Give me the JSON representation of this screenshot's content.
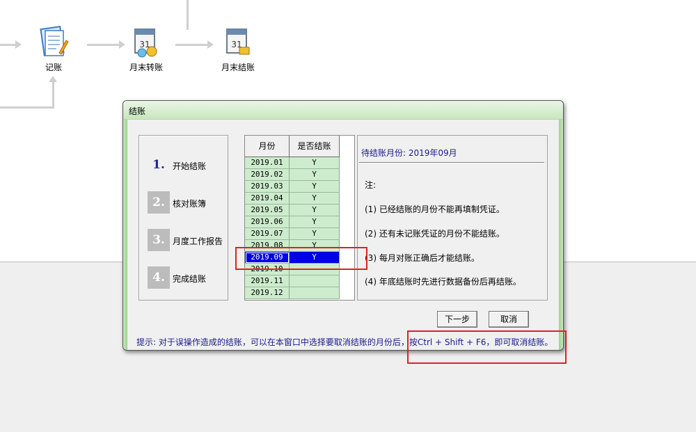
{
  "flow": {
    "nodes": [
      {
        "label": "记账",
        "icon": "ledger-icon"
      },
      {
        "label": "月末转账",
        "icon": "calendar-transfer-icon"
      },
      {
        "label": "月末结账",
        "icon": "calendar-close-icon"
      }
    ]
  },
  "dialog": {
    "title": "结账",
    "steps": [
      {
        "num": "1.",
        "label": "开始结账",
        "active": true
      },
      {
        "num": "2.",
        "label": "核对账簿",
        "active": false
      },
      {
        "num": "3.",
        "label": "月度工作报告",
        "active": false
      },
      {
        "num": "4.",
        "label": "完成结账",
        "active": false
      }
    ],
    "table": {
      "headers": [
        "月份",
        "是否结账"
      ],
      "rows": [
        {
          "month": "2019.01",
          "closed": "Y"
        },
        {
          "month": "2019.02",
          "closed": "Y"
        },
        {
          "month": "2019.03",
          "closed": "Y"
        },
        {
          "month": "2019.04",
          "closed": "Y"
        },
        {
          "month": "2019.05",
          "closed": "Y"
        },
        {
          "month": "2019.06",
          "closed": "Y"
        },
        {
          "month": "2019.07",
          "closed": "Y"
        },
        {
          "month": "2019.08",
          "closed": "Y"
        },
        {
          "month": "2019.09",
          "closed": "Y"
        },
        {
          "month": "2019.10",
          "closed": ""
        },
        {
          "month": "2019.11",
          "closed": ""
        },
        {
          "month": "2019.12",
          "closed": ""
        }
      ],
      "selected_row": 8
    },
    "info": {
      "pending": "待结账月份: 2019年09月",
      "notes_title": "注:",
      "notes": [
        "(1) 已经结账的月份不能再填制凭证。",
        "(2) 还有未记账凭证的月份不能结账。",
        "(3) 每月对账正确后才能结账。",
        "(4) 年底结账时先进行数据备份后再结账。"
      ]
    },
    "buttons": {
      "next": "下一步",
      "cancel": "取消"
    },
    "tip": "提示: 对于误操作造成的结账，可以在本窗口中选择要取消结账的月份后，按Ctrl + Shift + F6，即可取消结账。"
  },
  "colors": {
    "highlight": "#e02020",
    "selection": "#0000e6",
    "row_bg": "#cdeccd",
    "info_text": "#1a1a8a"
  }
}
